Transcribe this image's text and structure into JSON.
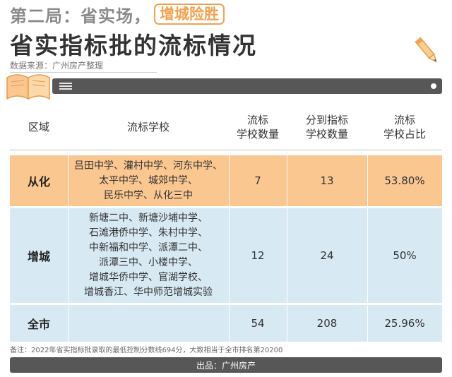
{
  "title": {
    "prefix": "第二局：省实场，",
    "badge": "增城险胜",
    "main": "省实指标批的流标情况"
  },
  "source": "数据来源：广州房产整理",
  "table": {
    "headers": [
      "区域",
      "流标学校",
      "流标\n学校数量",
      "分到指标\n学校数量",
      "流标\n学校占比"
    ],
    "rows": [
      {
        "region": "从化",
        "schools": "吕田中学、灌村中学、河东中学、\n太平中学、城郊中学、\n民乐中学、从化三中",
        "failed_count": "7",
        "assigned_count": "13",
        "ratio": "53.80%"
      },
      {
        "region": "增城",
        "schools": "新塘二中、新塘沙埔中学、\n石滩港侨中学、朱村中学、\n中新福和中学、派潭二中、\n派潭三中、小楼中学、\n增城华侨中学、官湖学校、\n增城香江、华中师范增城实验",
        "failed_count": "12",
        "assigned_count": "24",
        "ratio": "50%"
      },
      {
        "region": "全市",
        "schools": "",
        "failed_count": "54",
        "assigned_count": "208",
        "ratio": "25.96%"
      }
    ]
  },
  "footnote": "备注：2022年省实指标批录取的最低控制分数线694分，大致相当于全市排名第20200",
  "footer": "出品：广州房产",
  "colors": {
    "orange_row": "#fbc791",
    "blue_row": "#d7e9f3",
    "accent": "#f2a24f",
    "dark_bar": "#575757"
  }
}
